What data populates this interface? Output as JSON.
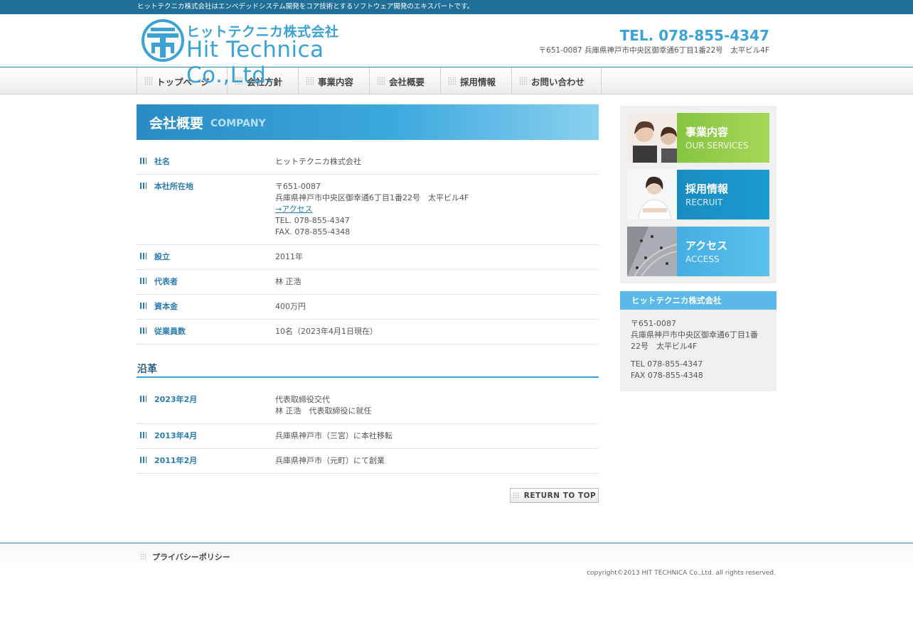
{
  "topbar": {
    "text": "ヒットテクニカ株式会社はエンベデッドシステム開発をコア技術とするソフトウェア開発のエキスパートです。"
  },
  "header": {
    "logo_jp": "ヒットテクニカ株式会社",
    "logo_en": "Hit Technica Co.,Ltd.",
    "tel": "TEL. 078-855-4347",
    "address": "〒651-0087 兵庫県神戸市中央区御幸通6丁目1番22号　太平ビル4F"
  },
  "nav": {
    "items": [
      {
        "label": "トップページ"
      },
      {
        "label": "会社方針"
      },
      {
        "label": "事業内容"
      },
      {
        "label": "会社概要"
      },
      {
        "label": "採用情報"
      },
      {
        "label": "お問い合わせ"
      }
    ]
  },
  "page": {
    "title": "会社概要",
    "title_en": "COMPANY"
  },
  "profile": [
    {
      "key": "社名",
      "lines": [
        "ヒットテクニカ株式会社"
      ]
    },
    {
      "key": "本社所在地",
      "lines": [
        "〒651-0087",
        "兵庫県神戸市中央区御幸通6丁目1番22号　太平ビル4F"
      ],
      "link": "→アクセス",
      "lines2": [
        "TEL. 078-855-4347",
        "FAX. 078-855-4348"
      ]
    },
    {
      "key": "設立",
      "lines": [
        "2011年"
      ]
    },
    {
      "key": "代表者",
      "lines": [
        "林 正浩"
      ]
    },
    {
      "key": "資本金",
      "lines": [
        "400万円"
      ]
    },
    {
      "key": "従業員数",
      "lines": [
        "10名（2023年4月1日現在）"
      ]
    }
  ],
  "history_title": "沿革",
  "history": [
    {
      "key": "2023年2月",
      "lines": [
        "代表取締役交代",
        "林 正浩　代表取締役に就任"
      ]
    },
    {
      "key": "2013年4月",
      "lines": [
        "兵庫県神戸市（三宮）に本社移転"
      ]
    },
    {
      "key": "2011年2月",
      "lines": [
        "兵庫県神戸市（元町）にて創業"
      ]
    }
  ],
  "return_top": "RETURN TO TOP",
  "sidebar": {
    "banners": [
      {
        "jp": "事業内容",
        "en": "OUR SERVICES",
        "color": "#8cc63f"
      },
      {
        "jp": "採用情報",
        "en": "RECRUIT",
        "color": "#1a8fc4"
      },
      {
        "jp": "アクセス",
        "en": "ACCESS",
        "color": "#49b6e6"
      }
    ],
    "company": {
      "title": "ヒットテクニカ株式会社",
      "postal": "〒651-0087",
      "address": "兵庫県神戸市中央区御幸通6丁目1番22号　太平ビル4F",
      "tel": "TEL 078-855-4347",
      "fax": "FAX 078-855-4348"
    }
  },
  "footer": {
    "privacy": "プライバシーポリシー",
    "copyright": "copyright©2013 HIT TECHNICA Co.,Ltd. all rights reserved."
  }
}
